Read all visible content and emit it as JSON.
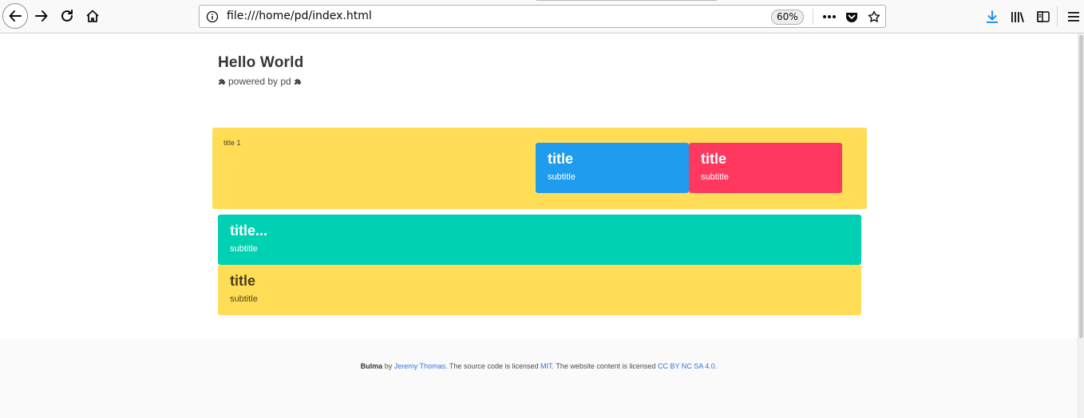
{
  "browser": {
    "url": "file:///home/pd/index.html",
    "zoom": "60%",
    "icons": [
      "back-icon",
      "forward-icon",
      "reload-icon",
      "home-icon",
      "info-icon",
      "more-icon",
      "pocket-icon",
      "bookmark-star-icon",
      "download-icon",
      "library-icon",
      "sidebar-icon",
      "hamburger-menu-icon"
    ]
  },
  "hero": {
    "title": "Hello World",
    "subtitle": "powered by pd"
  },
  "tiles": {
    "ancestor_title": "title 1",
    "blue": {
      "title": "title",
      "subtitle": "subtitle"
    },
    "red": {
      "title": "title",
      "subtitle": "subtitle"
    },
    "teal": {
      "title": "title...",
      "subtitle": "subtitle"
    },
    "yellow": {
      "title": "title",
      "subtitle": "subtitle"
    }
  },
  "footer": {
    "brand": "Bulma",
    "by": "by",
    "author": "Jeremy Thomas",
    "text1": ". The source code is licensed",
    "license_code": "MIT",
    "text2": ". The website content is licensed",
    "license_content": "CC BY NC SA 4.0",
    "end": "."
  },
  "colors": {
    "yellow": "#ffdd57",
    "info": "#209cee",
    "danger": "#ff3860",
    "primary": "#00d1b2",
    "link": "#3273dc",
    "download_accent": "#0a84ff"
  }
}
